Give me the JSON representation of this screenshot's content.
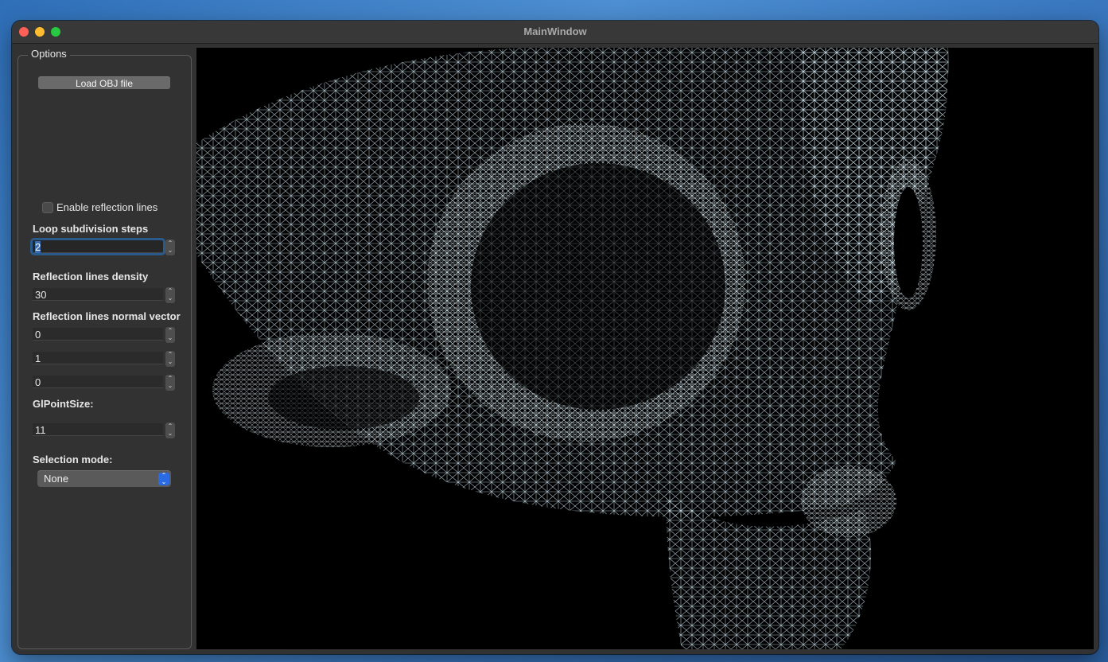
{
  "window": {
    "title": "MainWindow"
  },
  "options": {
    "title": "Options",
    "load_button": "Load OBJ file",
    "reflection_checkbox": {
      "label": "Enable reflection lines",
      "checked": false
    },
    "loop_subdivision": {
      "label": "Loop subdivision steps",
      "value": "2"
    },
    "density": {
      "label": "Reflection lines density",
      "value": "30"
    },
    "normal_vector": {
      "label": "Reflection lines normal vector",
      "x": "0",
      "y": "1",
      "z": "0"
    },
    "point_size": {
      "label": "GlPointSize:",
      "value": "11"
    },
    "selection_mode": {
      "label": "Selection mode:",
      "value": "None"
    }
  },
  "viewport": {
    "content": "wireframe mesh render",
    "wire_color": "#c8dde6"
  }
}
